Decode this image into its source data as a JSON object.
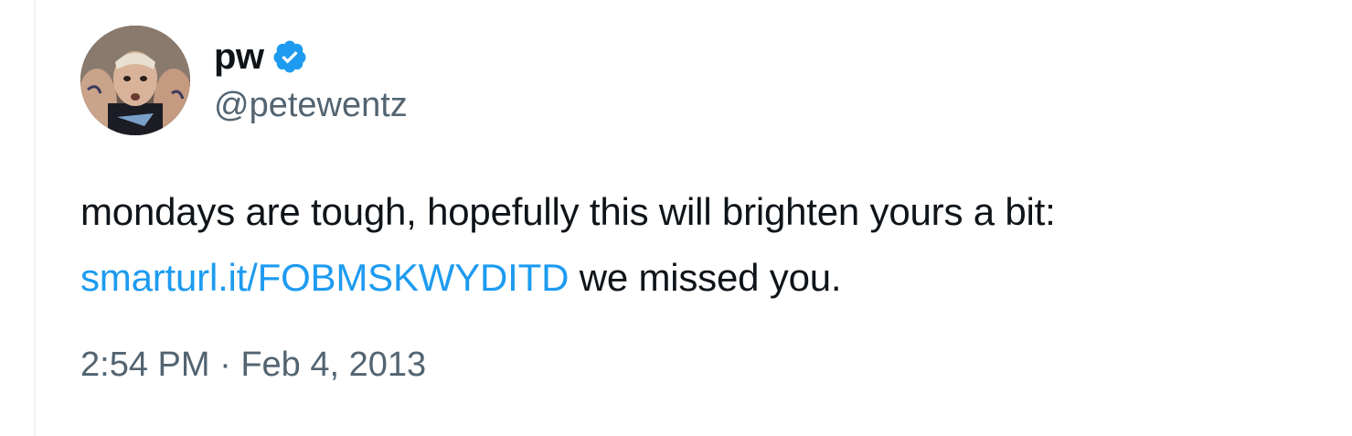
{
  "author": {
    "display_name": "pw",
    "handle": "@petewentz",
    "verified_icon": "verified-badge-icon",
    "verified_color": "#1d9bf0"
  },
  "tweet": {
    "text_line1": "mondays are tough, hopefully this will brighten yours a bit:",
    "link": "smarturl.it/FOBMSKWYDITD",
    "text_after_link": "we missed you."
  },
  "meta": {
    "time": "2:54 PM",
    "separator": "·",
    "date": "Feb 4, 2013"
  },
  "colors": {
    "text": "#0f1419",
    "secondary": "#536471",
    "link": "#1d9bf0"
  }
}
